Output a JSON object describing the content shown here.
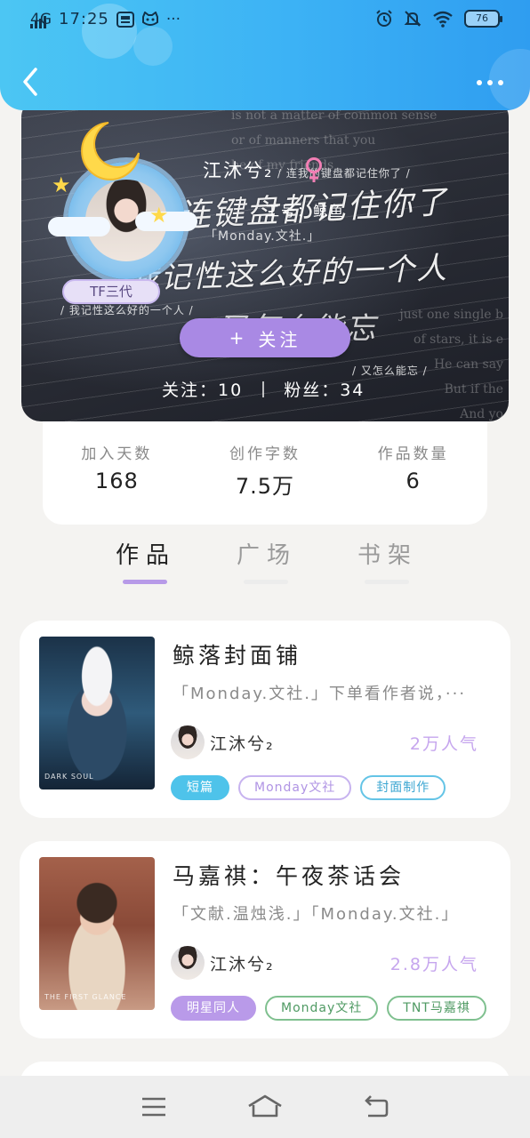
{
  "status_bar": {
    "network": "4G",
    "time": "17:25",
    "battery": "76",
    "more": "···"
  },
  "banner": {
    "user_name": "江沐兮₂",
    "job_id": "工号：鲸鱼",
    "org_tag": "「Monday.文社.」",
    "level_badge": "TF三代",
    "small_text_1": "/ 我记性这么好的一个人 /",
    "small_text_2": "/ 连我的键盘都记住你了 /",
    "small_text_3": "/ 又怎么能忘 /",
    "handwriting_1": "连键盘都记住你了",
    "handwriting_2": "我记性这么好的一个人",
    "handwriting_3": "又怎么能忘",
    "follow_label": "关注",
    "follow_plus": "+",
    "following_label": "关注：",
    "following_count": "10",
    "fans_label": "粉丝：",
    "fans_count": "34",
    "book_text_1": "is not a matter of common sense\nor of manners that you\nbe of my friends",
    "book_text_2": "just one single b\nof stars, it is e\nHe can say\nBut if the\nAnd yo"
  },
  "stats": [
    {
      "label": "加入天数",
      "value": "168"
    },
    {
      "label": "创作字数",
      "value": "7.5万"
    },
    {
      "label": "作品数量",
      "value": "6"
    }
  ],
  "tabs": [
    {
      "label": "作品",
      "active": true
    },
    {
      "label": "广场",
      "active": false
    },
    {
      "label": "书架",
      "active": false
    }
  ],
  "works": [
    {
      "title": "鲸落封面铺",
      "desc": "「Monday.文社.」下单看作者说，···",
      "author": "江沐兮₂",
      "popularity": "2万人气",
      "cover_text": "DARK SOUL",
      "tags": [
        {
          "label": "短篇",
          "style": "blue-fill"
        },
        {
          "label": "Monday文社",
          "style": "purple-out"
        },
        {
          "label": "封面制作",
          "style": "cyan-out"
        }
      ]
    },
    {
      "title": "马嘉祺：午夜茶话会",
      "desc": "「文献.温烛浅.」「Monday.文社.」",
      "author": "江沐兮₂",
      "popularity": "2.8万人气",
      "cover_text": "THE FIRST GLANCE",
      "tags": [
        {
          "label": "明星同人",
          "style": "purple-fill"
        },
        {
          "label": "Monday文社",
          "style": "green-out"
        },
        {
          "label": "TNT马嘉祺",
          "style": "green-out"
        }
      ]
    }
  ],
  "colors": {
    "header_gradient_start": "#4cc6f3",
    "header_gradient_end": "#2f9df0",
    "accent_purple": "#a989e4",
    "tab_underline": "#b79ae8",
    "popularity": "#c6a6ee"
  }
}
